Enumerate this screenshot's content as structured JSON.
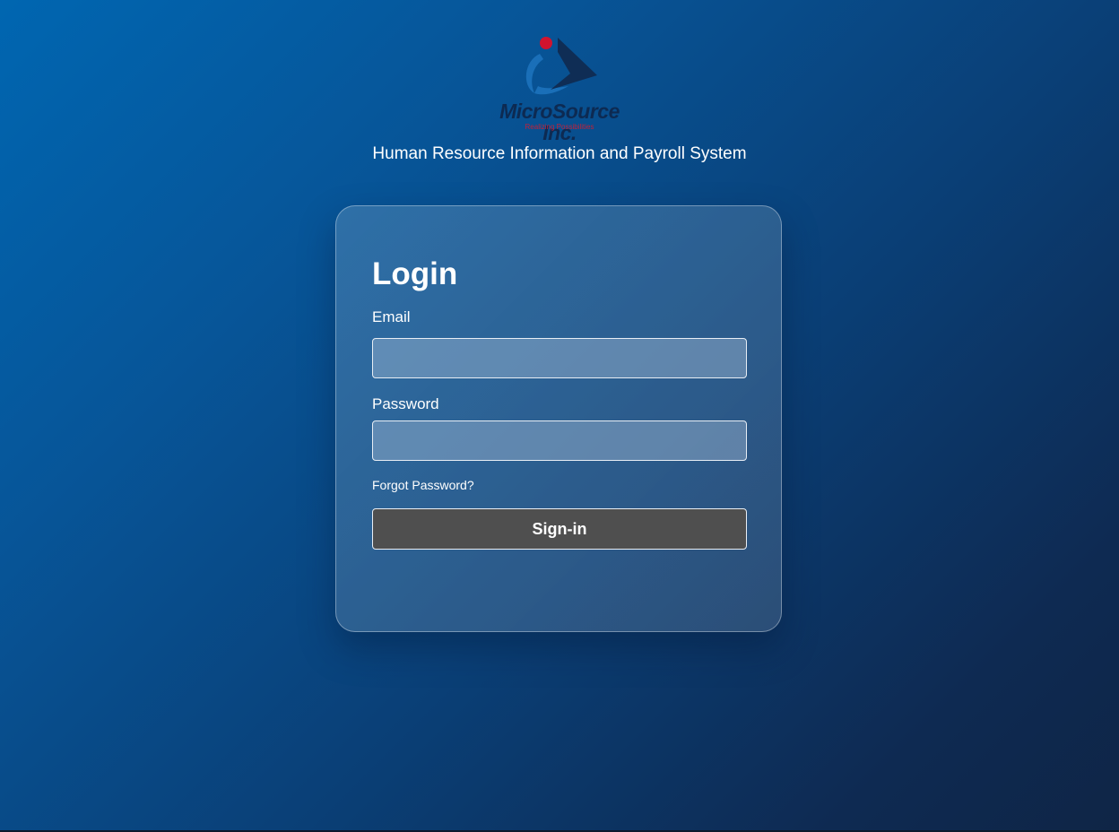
{
  "brand": {
    "name": "MicroSource Inc.",
    "tagline": "Realizing Possibilities",
    "logo_icon": "microsource-logo-icon",
    "colors": {
      "navy": "#0d2a52",
      "blue": "#1a6fb8",
      "red": "#c0213a"
    }
  },
  "header": {
    "subtitle": "Human Resource Information and Payroll System"
  },
  "login": {
    "title": "Login",
    "email_label": "Email",
    "email_value": "",
    "password_label": "Password",
    "password_value": "",
    "forgot_label": "Forgot Password?",
    "signin_label": "Sign-in"
  },
  "theme": {
    "background_start": "#0066b1",
    "background_end": "#0f2546",
    "button_color": "#4f4f4f"
  }
}
